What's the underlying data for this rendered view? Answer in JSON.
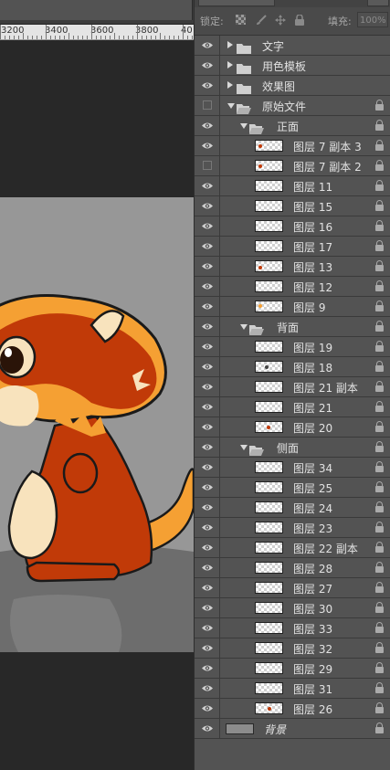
{
  "ruler": {
    "labels": [
      "3200",
      "3400",
      "3600",
      "3800",
      "40"
    ]
  },
  "lock_bar": {
    "lock_label": "锁定:",
    "icons": [
      "lock-transparent-icon",
      "lock-paint-icon",
      "lock-move-icon",
      "lock-all-icon"
    ],
    "fill_label": "填充:",
    "fill_value": "100%"
  },
  "layers": [
    {
      "name": "文字",
      "kind": "group",
      "collapsed": true,
      "indent": 0,
      "visible": true,
      "locked": false
    },
    {
      "name": "用色模板",
      "kind": "group",
      "collapsed": true,
      "indent": 0,
      "visible": true,
      "locked": false
    },
    {
      "name": "效果图",
      "kind": "group",
      "collapsed": true,
      "indent": 0,
      "visible": true,
      "locked": false
    },
    {
      "name": "原始文件",
      "kind": "group",
      "collapsed": false,
      "indent": 0,
      "visible": false,
      "locked": true
    },
    {
      "name": "正面",
      "kind": "group",
      "collapsed": false,
      "indent": 1,
      "visible": true,
      "locked": true
    },
    {
      "name": "图层 7 副本 3",
      "kind": "layer",
      "indent": 2,
      "visible": true,
      "locked": true
    },
    {
      "name": "图层 7 副本 2",
      "kind": "layer",
      "indent": 2,
      "visible": false,
      "locked": true
    },
    {
      "name": "图层 11",
      "kind": "layer",
      "indent": 2,
      "visible": true,
      "locked": true
    },
    {
      "name": "图层 15",
      "kind": "layer",
      "indent": 2,
      "visible": true,
      "locked": true
    },
    {
      "name": "图层 16",
      "kind": "layer",
      "indent": 2,
      "visible": true,
      "locked": true
    },
    {
      "name": "图层 17",
      "kind": "layer",
      "indent": 2,
      "visible": true,
      "locked": true
    },
    {
      "name": "图层 13",
      "kind": "layer",
      "indent": 2,
      "visible": true,
      "locked": true
    },
    {
      "name": "图层 12",
      "kind": "layer",
      "indent": 2,
      "visible": true,
      "locked": true
    },
    {
      "name": "图层 9",
      "kind": "layer",
      "indent": 2,
      "visible": true,
      "locked": true
    },
    {
      "name": "背面",
      "kind": "group",
      "collapsed": false,
      "indent": 1,
      "visible": true,
      "locked": true
    },
    {
      "name": "图层 19",
      "kind": "layer",
      "indent": 2,
      "visible": true,
      "locked": true
    },
    {
      "name": "图层 18",
      "kind": "layer",
      "indent": 2,
      "visible": true,
      "locked": true
    },
    {
      "name": "图层 21 副本",
      "kind": "layer",
      "indent": 2,
      "visible": true,
      "locked": true
    },
    {
      "name": "图层 21",
      "kind": "layer",
      "indent": 2,
      "visible": true,
      "locked": true
    },
    {
      "name": "图层 20",
      "kind": "layer",
      "indent": 2,
      "visible": true,
      "locked": true
    },
    {
      "name": "侧面",
      "kind": "group",
      "collapsed": false,
      "indent": 1,
      "visible": true,
      "locked": true
    },
    {
      "name": "图层 34",
      "kind": "layer",
      "indent": 2,
      "visible": true,
      "locked": true
    },
    {
      "name": "图层 25",
      "kind": "layer",
      "indent": 2,
      "visible": true,
      "locked": true
    },
    {
      "name": "图层 24",
      "kind": "layer",
      "indent": 2,
      "visible": true,
      "locked": true
    },
    {
      "name": "图层 23",
      "kind": "layer",
      "indent": 2,
      "visible": true,
      "locked": true
    },
    {
      "name": "图层 22 副本",
      "kind": "layer",
      "indent": 2,
      "visible": true,
      "locked": true
    },
    {
      "name": "图层 28",
      "kind": "layer",
      "indent": 2,
      "visible": true,
      "locked": true
    },
    {
      "name": "图层 27",
      "kind": "layer",
      "indent": 2,
      "visible": true,
      "locked": true
    },
    {
      "name": "图层 30",
      "kind": "layer",
      "indent": 2,
      "visible": true,
      "locked": true
    },
    {
      "name": "图层 33",
      "kind": "layer",
      "indent": 2,
      "visible": true,
      "locked": true
    },
    {
      "name": "图层 32",
      "kind": "layer",
      "indent": 2,
      "visible": true,
      "locked": true
    },
    {
      "name": "图层 29",
      "kind": "layer",
      "indent": 2,
      "visible": true,
      "locked": true
    },
    {
      "name": "图层 31",
      "kind": "layer",
      "indent": 2,
      "visible": true,
      "locked": true
    },
    {
      "name": "图层 26",
      "kind": "layer",
      "indent": 2,
      "visible": true,
      "locked": true
    },
    {
      "name": "背景",
      "kind": "background",
      "indent": 0,
      "visible": true,
      "locked": true,
      "italic": true
    }
  ],
  "colors": {
    "panel_bg": "#535353",
    "row_divider": "#3a3a3a",
    "text": "#e2e2e2",
    "canvas_gray": "#979797",
    "character_orange": "#f5a033",
    "character_red": "#c13a08",
    "character_cream": "#f8e3bd"
  }
}
